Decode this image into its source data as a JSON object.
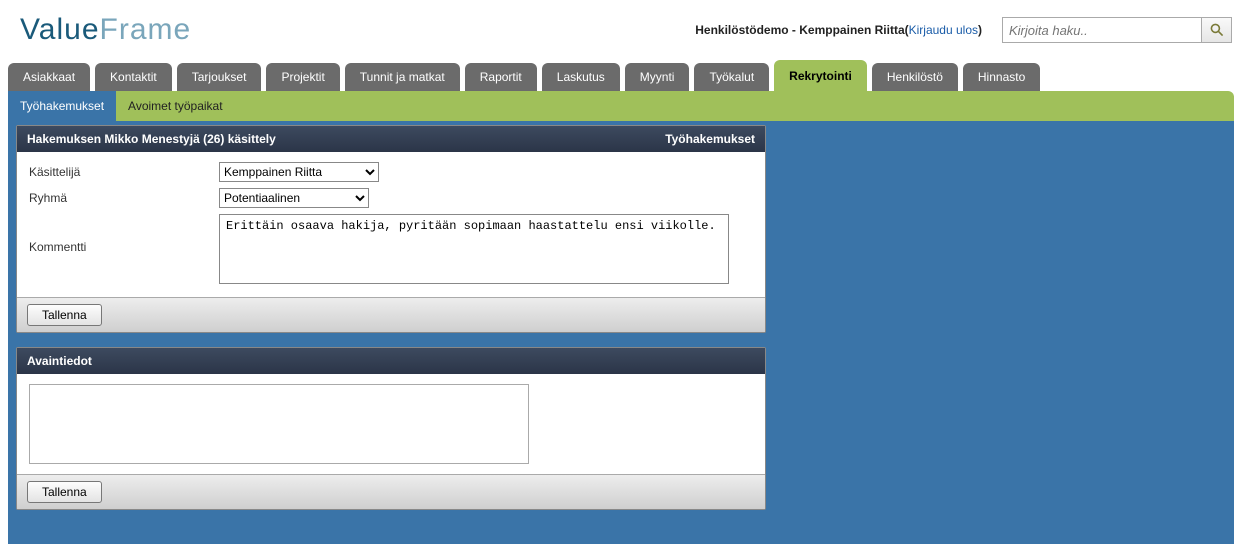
{
  "logo": {
    "part1": "Value",
    "part2": "Frame"
  },
  "header": {
    "user_prefix": "Henkilöstödemo - ",
    "user_name": "Kemppainen Riitta",
    "logout_open": "(",
    "logout_label": "Kirjaudu ulos",
    "logout_close": ")"
  },
  "search": {
    "placeholder": "Kirjoita haku.."
  },
  "tabs": [
    "Asiakkaat",
    "Kontaktit",
    "Tarjoukset",
    "Projektit",
    "Tunnit ja matkat",
    "Raportit",
    "Laskutus",
    "Myynti",
    "Työkalut",
    "Rekrytointi",
    "Henkilöstö",
    "Hinnasto"
  ],
  "tabs_active_index": 9,
  "subtabs": [
    "Työhakemukset",
    "Avoimet työpaikat"
  ],
  "subtabs_active_index": 0,
  "panel1": {
    "title": "Hakemuksen Mikko Menestyjä (26) käsittely",
    "right": "Työhakemukset",
    "fields": {
      "handler_label": "Käsittelijä",
      "handler_value": "Kemppainen Riitta",
      "group_label": "Ryhmä",
      "group_value": "Potentiaalinen",
      "comment_label": "Kommentti",
      "comment_value": "Erittäin osaava hakija, pyritään sopimaan haastattelu ensi viikolle."
    },
    "save_label": "Tallenna"
  },
  "panel2": {
    "title": "Avaintiedot",
    "save_label": "Tallenna"
  }
}
